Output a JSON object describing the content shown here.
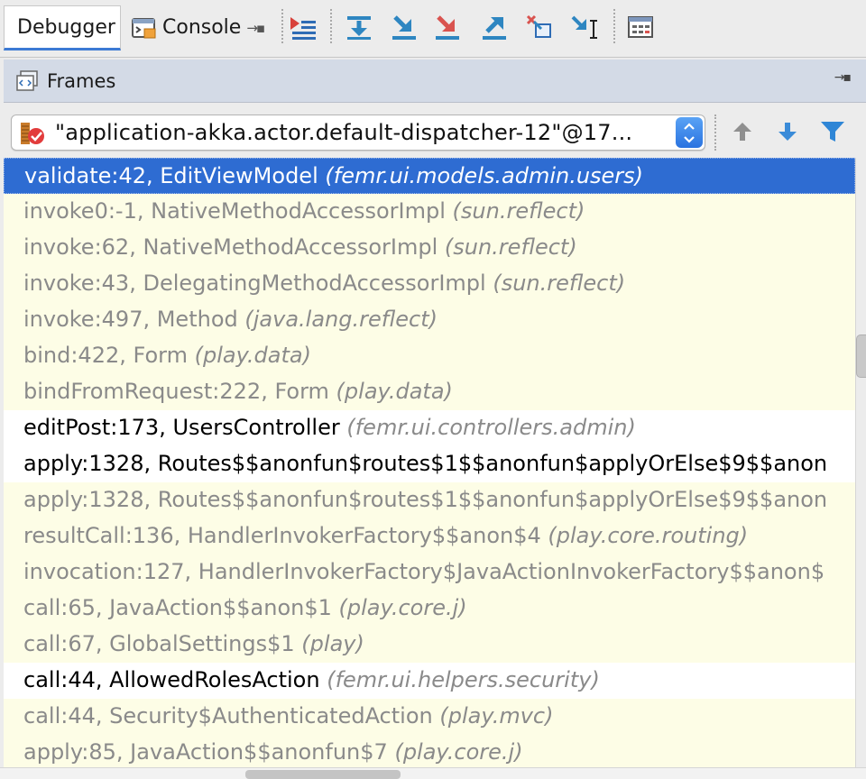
{
  "toolbar": {
    "tabs": [
      {
        "label": "Debugger",
        "active": true
      },
      {
        "label": "Console",
        "active": false
      }
    ],
    "buttons": [
      {
        "icon": "show-execution-point-icon",
        "color": "#c0392b"
      },
      {
        "icon": "step-over-icon",
        "color": "#2e86c1"
      },
      {
        "icon": "step-into-icon",
        "color": "#2e86c1"
      },
      {
        "icon": "force-step-into-icon",
        "color": "#d9534f"
      },
      {
        "icon": "step-out-icon",
        "color": "#2e86c1"
      },
      {
        "icon": "drop-frame-icon",
        "color": "#2e86c1"
      },
      {
        "icon": "run-to-cursor-icon",
        "color": "#2e86c1"
      },
      {
        "icon": "evaluate-expression-icon",
        "color": "#555555"
      }
    ]
  },
  "frames_panel": {
    "title": "Frames",
    "thread_selector": {
      "value": "\"application-akka.actor.default-dispatcher-12\"@17...",
      "icon": "thread-suspended-icon"
    },
    "nav": {
      "up_icon": "arrow-up-icon",
      "down_icon": "arrow-down-icon",
      "filter_icon": "filter-icon"
    },
    "frames": [
      {
        "method": "validate:42, EditViewModel",
        "package": "(femr.ui.models.admin.users)",
        "kind": "selected"
      },
      {
        "method": "invoke0:-1, NativeMethodAccessorImpl",
        "package": "(sun.reflect)",
        "kind": "library"
      },
      {
        "method": "invoke:62, NativeMethodAccessorImpl",
        "package": "(sun.reflect)",
        "kind": "library"
      },
      {
        "method": "invoke:43, DelegatingMethodAccessorImpl",
        "package": "(sun.reflect)",
        "kind": "library"
      },
      {
        "method": "invoke:497, Method",
        "package": "(java.lang.reflect)",
        "kind": "library"
      },
      {
        "method": "bind:422, Form",
        "package": "(play.data)",
        "kind": "library"
      },
      {
        "method": "bindFromRequest:222, Form",
        "package": "(play.data)",
        "kind": "library"
      },
      {
        "method": "editPost:173, UsersController",
        "package": "(femr.ui.controllers.admin)",
        "kind": "user"
      },
      {
        "method": "apply:1328, Routes$$anonfun$routes$1$$anonfun$applyOrElse$9$$anon",
        "package": "",
        "kind": "user"
      },
      {
        "method": "apply:1328, Routes$$anonfun$routes$1$$anonfun$applyOrElse$9$$anon",
        "package": "",
        "kind": "library"
      },
      {
        "method": "resultCall:136, HandlerInvokerFactory$$anon$4",
        "package": "(play.core.routing)",
        "kind": "library"
      },
      {
        "method": "invocation:127, HandlerInvokerFactory$JavaActionInvokerFactory$$anon$",
        "package": "",
        "kind": "library"
      },
      {
        "method": "call:65, JavaAction$$anon$1",
        "package": "(play.core.j)",
        "kind": "library"
      },
      {
        "method": "call:67, GlobalSettings$1",
        "package": "(play)",
        "kind": "library"
      },
      {
        "method": "call:44, AllowedRolesAction",
        "package": "(femr.ui.helpers.security)",
        "kind": "user"
      },
      {
        "method": "call:44, Security$AuthenticatedAction",
        "package": "(play.mvc)",
        "kind": "library"
      },
      {
        "method": "apply:85, JavaAction$$anonfun$7",
        "package": "(play.core.j)",
        "kind": "library"
      }
    ]
  },
  "colors": {
    "selection": "#2e6cd2",
    "library_frame_bg": "#fdfde6",
    "user_frame_bg": "#ffffff",
    "header_bg": "#d3dae6"
  }
}
